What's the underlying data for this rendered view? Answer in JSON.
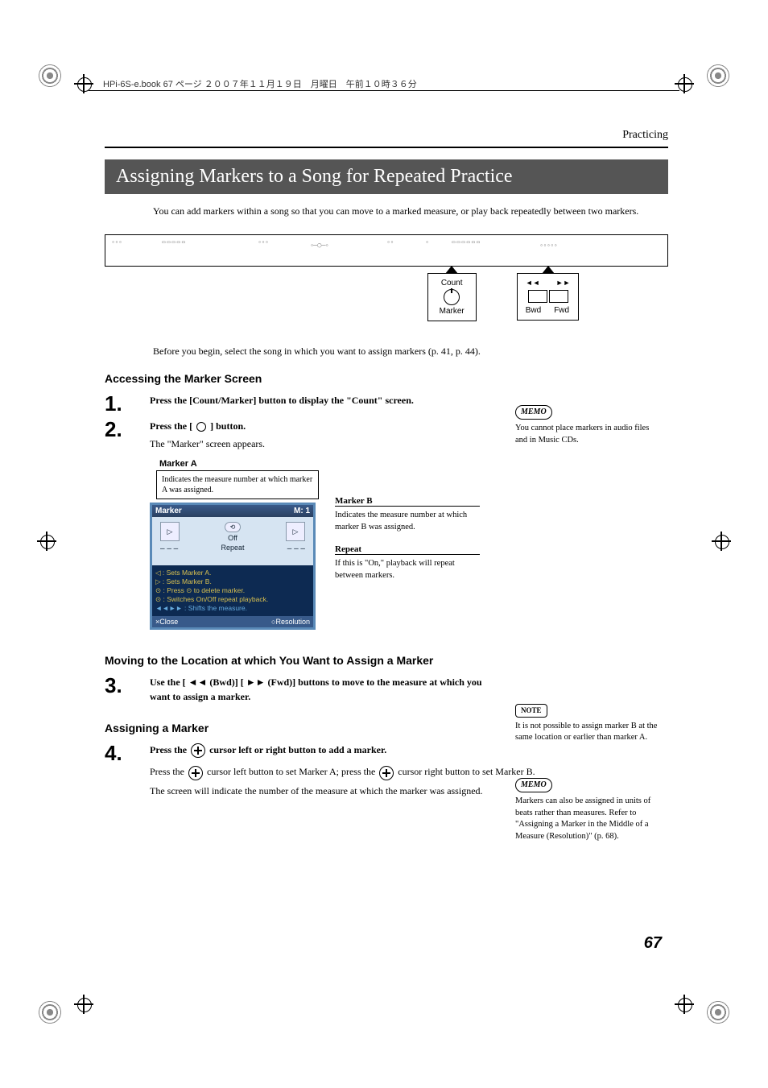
{
  "header_info": "HPi-6S-e.book  67 ページ  ２００７年１１月１９日　月曜日　午前１０時３６分",
  "section_label": "Practicing",
  "title": "Assigning Markers to a Song for Repeated Practice",
  "intro": "You can add markers within a song so that you can move to a marked measure, or play back repeatedly between two markers.",
  "callout1": {
    "top": "Count",
    "bottom": "Marker"
  },
  "callout2": {
    "left_lbl": "Bwd",
    "right_lbl": "Fwd",
    "icon_l": "◄◄",
    "icon_r": "►►"
  },
  "before_begin": "Before you begin, select the song in which you want to assign markers (p. 41, p. 44).",
  "h3_access": "Accessing the Marker Screen",
  "step1": {
    "num": "1.",
    "bold": "Press the [Count/Marker] button to display the \"Count\" screen."
  },
  "step2": {
    "num": "2.",
    "bold_pre": "Press the [",
    "bold_post": "] button.",
    "after": "The \"Marker\" screen appears."
  },
  "markerA": {
    "label": "Marker A",
    "text": "Indicates the measure number at which marker A was assigned."
  },
  "lcd": {
    "title_l": "Marker",
    "title_r": "M:   1",
    "repeat_off": "Off",
    "repeat_lbl": "Repeat",
    "dash": "– – –",
    "help1": ": Sets Marker A.",
    "help2": ": Sets Marker B.",
    "help3": ": Press ⊙ to delete marker.",
    "help4": ": Switches On/Off repeat playback.",
    "help5": ": Shifts the measure.",
    "foot_l": "×Close",
    "foot_r": "○Resolution"
  },
  "markerB": {
    "label": "Marker B",
    "text": "Indicates the measure number at which marker B was assigned."
  },
  "repeat_side": {
    "label": "Repeat",
    "text": "If this is \"On,\" playback will repeat between markers."
  },
  "h3_moving": "Moving to the Location at which You Want to Assign a Marker",
  "step3": {
    "num": "3.",
    "bold": "Use the [ ◄◄ (Bwd)] [ ►► (Fwd)] buttons to move to the measure at which you want to assign a marker."
  },
  "h3_assign": "Assigning a Marker",
  "step4": {
    "num": "4.",
    "bold_pre": "Press the ",
    "bold_post": " cursor left or right button to add a marker.",
    "after1_pre": "Press the ",
    "after1_mid": " cursor left button to set Marker A; press the ",
    "after1_post": " cursor right button to set Marker B.",
    "after2": "The screen will indicate the number of the measure at which the marker was assigned."
  },
  "memo1": "You cannot place markers in audio files and in Music CDs.",
  "note1": "It is not possible to assign marker B at the same location or earlier than marker A.",
  "memo2": "Markers can also be assigned in units of beats rather than measures. Refer to \"Assigning a Marker in the Middle of a Measure (Resolution)\" (p. 68).",
  "memo_label": "MEMO",
  "note_label": "NOTE",
  "page_num": "67"
}
